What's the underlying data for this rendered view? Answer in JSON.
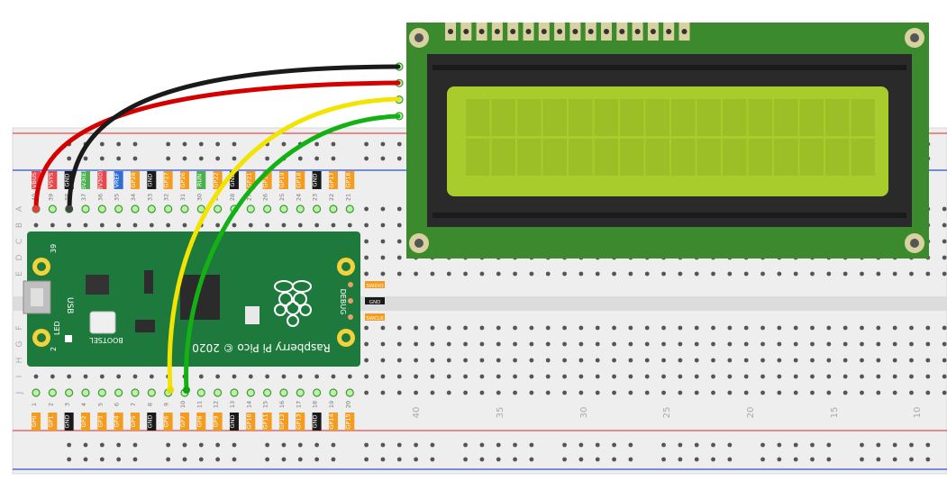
{
  "colors": {
    "board_green": "#1e7a3c",
    "lcd_pcb": "#3c8a2e",
    "lcd_screen": "#a9cc2d",
    "wire_red": "#d40000",
    "wire_black": "#1a1a1a",
    "wire_yellow": "#f2e400",
    "wire_green": "#14b114",
    "pin_power_red": "#e8474b",
    "pin_gp_orange": "#f39c1f",
    "pin_gnd_black": "#1a1a1a",
    "pin_run_green": "#4caf50",
    "pin_vref_blue": "#2f6fd4"
  },
  "breadboard": {
    "row_letters_top": [
      "A",
      "B",
      "C",
      "D",
      "E"
    ],
    "row_letters_bottom": [
      "F",
      "G",
      "H",
      "I",
      "J"
    ],
    "column_numbers": [
      "40",
      "35",
      "30",
      "25",
      "20",
      "15",
      "10"
    ]
  },
  "pico": {
    "name": "Raspberry Pi Pico © 2020",
    "usb_label": "USB",
    "led_label": "LED",
    "bootsel_label": "BOOTSEL",
    "debug_label": "DEBUG",
    "corner_top": "39",
    "corner_bottom": "2",
    "debug_pins": [
      "SWDIO",
      "GND",
      "SWCLK"
    ],
    "top_pins": [
      {
        "num": "40",
        "label": "VBUS",
        "kind": "power"
      },
      {
        "num": "39",
        "label": "VSYS",
        "kind": "power"
      },
      {
        "num": "38",
        "label": "GND",
        "kind": "gnd"
      },
      {
        "num": "37",
        "label": "3V3(E)",
        "kind": "run"
      },
      {
        "num": "36",
        "label": "3V3(O)",
        "kind": "power"
      },
      {
        "num": "35",
        "label": "VREF",
        "kind": "vref"
      },
      {
        "num": "34",
        "label": "GP28",
        "kind": "gp"
      },
      {
        "num": "33",
        "label": "GND",
        "kind": "gnd"
      },
      {
        "num": "32",
        "label": "GP27",
        "kind": "gp"
      },
      {
        "num": "31",
        "label": "GP26",
        "kind": "gp"
      },
      {
        "num": "30",
        "label": "RUN",
        "kind": "run"
      },
      {
        "num": "29",
        "label": "GP22",
        "kind": "gp"
      },
      {
        "num": "28",
        "label": "GND",
        "kind": "gnd"
      },
      {
        "num": "27",
        "label": "GP21",
        "kind": "gp"
      },
      {
        "num": "26",
        "label": "GP20",
        "kind": "gp"
      },
      {
        "num": "25",
        "label": "GP19",
        "kind": "gp"
      },
      {
        "num": "24",
        "label": "GP18",
        "kind": "gp"
      },
      {
        "num": "23",
        "label": "GND",
        "kind": "gnd"
      },
      {
        "num": "22",
        "label": "GP17",
        "kind": "gp"
      },
      {
        "num": "21",
        "label": "GP16",
        "kind": "gp"
      }
    ],
    "bottom_pins": [
      {
        "num": "1",
        "label": "GP0",
        "kind": "gp"
      },
      {
        "num": "2",
        "label": "GP1",
        "kind": "gp"
      },
      {
        "num": "3",
        "label": "GND",
        "kind": "gnd"
      },
      {
        "num": "4",
        "label": "GP2",
        "kind": "gp"
      },
      {
        "num": "5",
        "label": "GP3",
        "kind": "gp"
      },
      {
        "num": "6",
        "label": "GP4",
        "kind": "gp"
      },
      {
        "num": "7",
        "label": "GP5",
        "kind": "gp"
      },
      {
        "num": "8",
        "label": "GND",
        "kind": "gnd"
      },
      {
        "num": "9",
        "label": "GP6",
        "kind": "gp"
      },
      {
        "num": "10",
        "label": "GP7",
        "kind": "gp"
      },
      {
        "num": "11",
        "label": "GP8",
        "kind": "gp"
      },
      {
        "num": "12",
        "label": "GP9",
        "kind": "gp"
      },
      {
        "num": "13",
        "label": "GND",
        "kind": "gnd"
      },
      {
        "num": "14",
        "label": "GP10",
        "kind": "gp"
      },
      {
        "num": "15",
        "label": "GP11",
        "kind": "gp"
      },
      {
        "num": "16",
        "label": "GP12",
        "kind": "gp"
      },
      {
        "num": "17",
        "label": "GP13",
        "kind": "gp"
      },
      {
        "num": "18",
        "label": "GND",
        "kind": "gnd"
      },
      {
        "num": "19",
        "label": "GP14",
        "kind": "gp"
      },
      {
        "num": "20",
        "label": "GP15",
        "kind": "gp"
      }
    ]
  },
  "lcd": {
    "rows": 2,
    "cols": 16,
    "header_pins": 16,
    "i2c_pins": 4
  },
  "wires": [
    {
      "color": "red",
      "from": "VBUS",
      "to": "LCD VCC"
    },
    {
      "color": "black",
      "from": "GND",
      "to": "LCD GND"
    },
    {
      "color": "yellow",
      "from": "GP6",
      "to": "LCD SDA"
    },
    {
      "color": "green",
      "from": "GP7",
      "to": "LCD SCL"
    }
  ]
}
